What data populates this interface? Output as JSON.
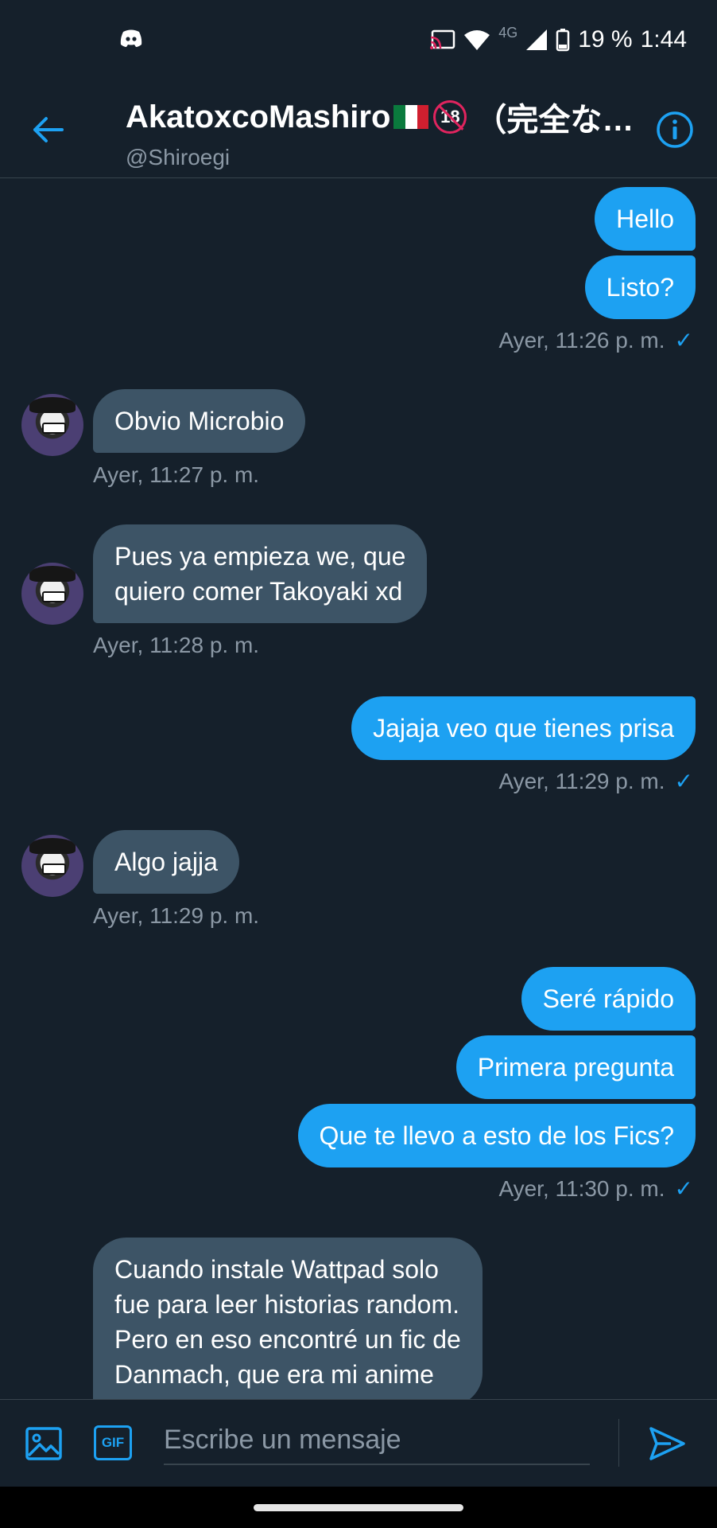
{
  "status_bar": {
    "app_icon": "discord-icon",
    "network": "4G",
    "battery": "19 %",
    "time": "1:44"
  },
  "header": {
    "name": "AkatoxcoMashiro",
    "name_suffix": "（完全な…",
    "handle": "@Shiroegi",
    "flag_icon": "mexico-flag-icon",
    "badge_icon": "no-under-18-icon",
    "badge_text": "18"
  },
  "messages": [
    {
      "dir": "out",
      "text": "Hello"
    },
    {
      "dir": "out",
      "text": "Listo?"
    },
    {
      "timestamp": "Ayer, 11:26 p. m."
    },
    {
      "dir": "in",
      "text": "Obvio Microbio"
    },
    {
      "timestamp": "Ayer, 11:27 p. m."
    },
    {
      "dir": "in",
      "text": "Pues ya empieza we, que\nquiero comer Takoyaki xd"
    },
    {
      "timestamp": "Ayer, 11:28 p. m."
    },
    {
      "dir": "out",
      "text": "Jajaja veo que tienes prisa"
    },
    {
      "timestamp": "Ayer, 11:29 p. m."
    },
    {
      "dir": "in",
      "text": "Algo jajja"
    },
    {
      "timestamp": "Ayer, 11:29 p. m."
    },
    {
      "dir": "out",
      "text": "Seré rápido"
    },
    {
      "dir": "out",
      "text": "Primera pregunta"
    },
    {
      "dir": "out",
      "text": "Que te llevo a esto de los Fics?"
    },
    {
      "timestamp": "Ayer, 11:30 p. m."
    },
    {
      "dir": "in",
      "text": "Cuando instale Wattpad solo\nfue para leer historias random.\nPero en eso encontré un fic de\nDanmach, que era mi anime"
    }
  ],
  "composer": {
    "placeholder": "Escribe un mensaje",
    "gif_label": "GIF"
  },
  "colors": {
    "background": "#15202b",
    "outgoing_bubble": "#1da1f2",
    "incoming_bubble": "#3d5466",
    "muted_text": "#8b98a5",
    "accent": "#1da1f2"
  }
}
